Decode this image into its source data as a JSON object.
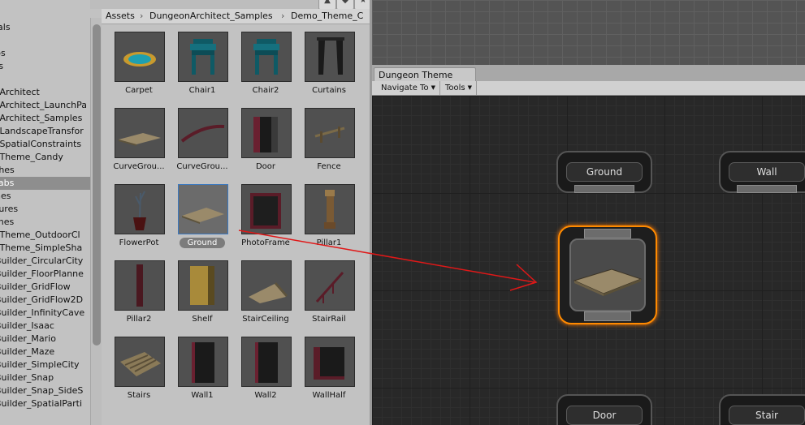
{
  "tree": {
    "items": [
      {
        "label": "ials",
        "selected": false
      },
      {
        "label": "s",
        "selected": false
      },
      {
        "label": "bs",
        "selected": false
      },
      {
        "label": "ts",
        "selected": false
      },
      {
        "label": "",
        "selected": false
      },
      {
        "label": "_Architect",
        "selected": false
      },
      {
        "label": "_Architect_LaunchPa",
        "selected": false
      },
      {
        "label": "_Architect_Samples",
        "selected": false
      },
      {
        "label": "_LandscapeTransfor",
        "selected": false
      },
      {
        "label": "_SpatialConstraints",
        "selected": false
      },
      {
        "label": "_Theme_Candy",
        "selected": false
      },
      {
        "label": "thes",
        "selected": false
      },
      {
        "label": "fabs",
        "selected": true
      },
      {
        "label": "nes",
        "selected": false
      },
      {
        "label": "tures",
        "selected": false
      },
      {
        "label": "mes",
        "selected": false
      },
      {
        "label": "_Theme_OutdoorCl",
        "selected": false
      },
      {
        "label": "_Theme_SimpleSha",
        "selected": false
      },
      {
        "label": "Builder_CircularCity",
        "selected": false
      },
      {
        "label": "Builder_FloorPlanne",
        "selected": false
      },
      {
        "label": "Builder_GridFlow",
        "selected": false
      },
      {
        "label": "Builder_GridFlow2D",
        "selected": false
      },
      {
        "label": "Builder_InfinityCave",
        "selected": false
      },
      {
        "label": "Builder_Isaac",
        "selected": false
      },
      {
        "label": "Builder_Mario",
        "selected": false
      },
      {
        "label": "Builder_Maze",
        "selected": false
      },
      {
        "label": "Builder_SimpleCity",
        "selected": false
      },
      {
        "label": "Builder_Snap",
        "selected": false
      },
      {
        "label": "Builder_Snap_SideS",
        "selected": false
      },
      {
        "label": "Builder_SpatialParti",
        "selected": false
      }
    ]
  },
  "breadcrumb": [
    "Assets",
    "DungeonArchitect_Samples",
    "Demo_Theme_C"
  ],
  "breadcrumb_separator": "›",
  "assets": [
    {
      "name": "Carpet",
      "icon": "carpet-icon",
      "selected": false
    },
    {
      "name": "Chair1",
      "icon": "chair-icon",
      "selected": false
    },
    {
      "name": "Chair2",
      "icon": "chair-icon",
      "selected": false
    },
    {
      "name": "Curtains",
      "icon": "curtains-icon",
      "selected": false
    },
    {
      "name": "CurveGrou...",
      "icon": "curve-ground-icon",
      "selected": false
    },
    {
      "name": "CurveGrou...",
      "icon": "curve-rail-icon",
      "selected": false
    },
    {
      "name": "Door",
      "icon": "door-icon",
      "selected": false
    },
    {
      "name": "Fence",
      "icon": "fence-icon",
      "selected": false
    },
    {
      "name": "FlowerPot",
      "icon": "flowerpot-icon",
      "selected": false
    },
    {
      "name": "Ground",
      "icon": "ground-icon",
      "selected": true
    },
    {
      "name": "PhotoFrame",
      "icon": "photoframe-icon",
      "selected": false
    },
    {
      "name": "Pillar1",
      "icon": "pillar-icon",
      "selected": false
    },
    {
      "name": "Pillar2",
      "icon": "pillar2-icon",
      "selected": false
    },
    {
      "name": "Shelf",
      "icon": "shelf-icon",
      "selected": false
    },
    {
      "name": "StairCeiling",
      "icon": "stair-ceiling-icon",
      "selected": false
    },
    {
      "name": "StairRail",
      "icon": "stair-rail-icon",
      "selected": false
    },
    {
      "name": "Stairs",
      "icon": "stairs-icon",
      "selected": false
    },
    {
      "name": "Wall1",
      "icon": "wall-icon",
      "selected": false
    },
    {
      "name": "Wall2",
      "icon": "wall-icon",
      "selected": false
    },
    {
      "name": "WallHalf",
      "icon": "wall-half-icon",
      "selected": false
    }
  ],
  "dungeon_theme": {
    "tab_title": "Dungeon Theme",
    "toolbar": {
      "navigate_label": "Navigate To",
      "tools_label": "Tools"
    },
    "nodes": {
      "ground": "Ground",
      "wall": "Wall",
      "door": "Door",
      "stair": "Stair"
    }
  },
  "colors": {
    "selection_outline": "#ff8a00",
    "drag_arrow": "#e01818"
  }
}
